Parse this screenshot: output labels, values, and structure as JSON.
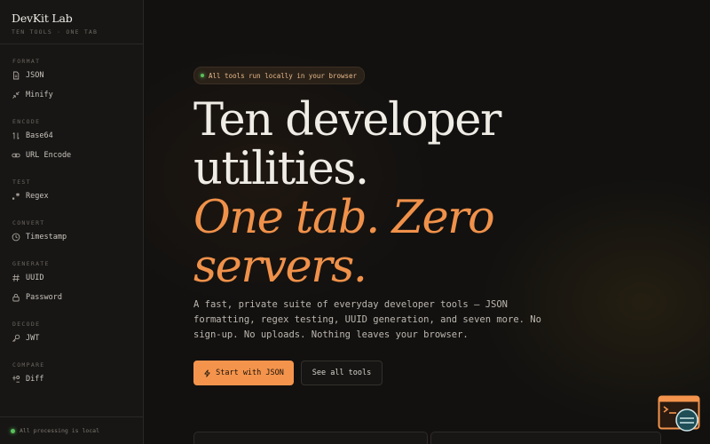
{
  "brand": {
    "title": "DevKit Lab",
    "subtitle": "TEN TOOLS · ONE TAB"
  },
  "sidebar": {
    "groups": [
      {
        "label": "FORMAT",
        "items": [
          {
            "label": "JSON",
            "icon": "file-icon"
          },
          {
            "label": "Minify",
            "icon": "compress-icon"
          }
        ]
      },
      {
        "label": "ENCODE",
        "items": [
          {
            "label": "Base64",
            "icon": "swap-icon"
          },
          {
            "label": "URL Encode",
            "icon": "link-icon"
          }
        ]
      },
      {
        "label": "TEST",
        "items": [
          {
            "label": "Regex",
            "icon": "regex-icon"
          }
        ]
      },
      {
        "label": "CONVERT",
        "items": [
          {
            "label": "Timestamp",
            "icon": "clock-icon"
          }
        ]
      },
      {
        "label": "GENERATE",
        "items": [
          {
            "label": "UUID",
            "icon": "hash-icon"
          },
          {
            "label": "Password",
            "icon": "lock-icon"
          }
        ]
      },
      {
        "label": "DECODE",
        "items": [
          {
            "label": "JWT",
            "icon": "key-icon"
          }
        ]
      },
      {
        "label": "COMPARE",
        "items": [
          {
            "label": "Diff",
            "icon": "diff-icon"
          }
        ]
      }
    ],
    "footer": "All processing is local"
  },
  "hero": {
    "badge": "All tools run locally in your browser",
    "headline_line1": "Ten developer",
    "headline_line2": "utilities.",
    "headline_accent1": "One tab. Zero",
    "headline_accent2": "servers.",
    "lede": "A fast, private suite of everyday developer tools — JSON formatting, regex testing, UUID generation, and seven more. No sign-up. No uploads. Nothing leaves your browser.",
    "primary_cta": "Start with JSON",
    "secondary_cta": "See all tools"
  },
  "colors": {
    "accent": "#f4944c",
    "background": "#121110",
    "sidebar": "#171615",
    "status_green": "#58c15a"
  }
}
